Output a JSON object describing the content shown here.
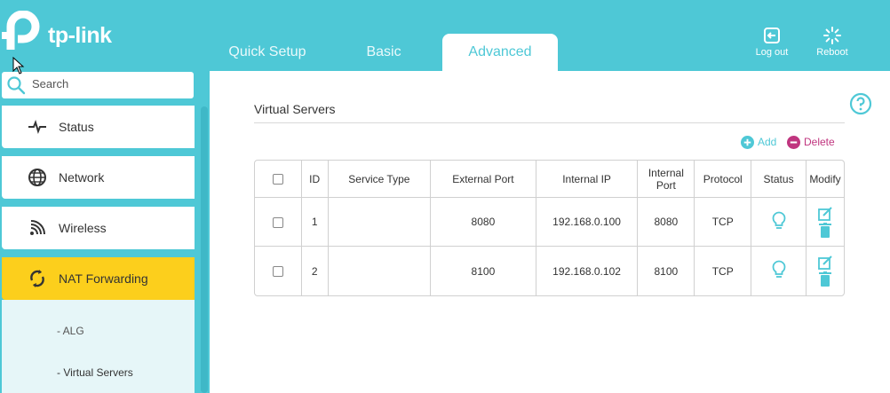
{
  "brand": {
    "logo_text": "tp-link"
  },
  "colors": {
    "header": "#4ec8d6",
    "active_menu": "#fccf1c",
    "delete": "#c0357f"
  },
  "tabs": [
    {
      "label": "Quick Setup",
      "active": false
    },
    {
      "label": "Basic",
      "active": false
    },
    {
      "label": "Advanced",
      "active": true
    }
  ],
  "header_buttons": {
    "logout": {
      "label": "Log out",
      "icon": "logout-icon"
    },
    "reboot": {
      "label": "Reboot",
      "icon": "reboot-icon"
    }
  },
  "sidebar": {
    "search": {
      "placeholder": "Search",
      "value": ""
    },
    "items": [
      {
        "label": "Status",
        "icon": "status-pulse-icon"
      },
      {
        "label": "Network",
        "icon": "globe-icon"
      },
      {
        "label": "Wireless",
        "icon": "wifi-icon"
      },
      {
        "label": "NAT Forwarding",
        "icon": "nat-forwarding-icon",
        "active": true
      }
    ],
    "submenu": [
      {
        "label": "- ALG"
      },
      {
        "label": "- Virtual Servers",
        "active": true
      }
    ]
  },
  "main": {
    "title": "Virtual Servers",
    "actions": {
      "add": "Add",
      "delete": "Delete"
    },
    "table": {
      "headers": {
        "id": "ID",
        "service_type": "Service Type",
        "external_port": "External Port",
        "internal_ip": "Internal IP",
        "internal_port": "Internal Port",
        "protocol": "Protocol",
        "status": "Status",
        "modify": "Modify"
      },
      "rows": [
        {
          "id": "1",
          "service_type": "",
          "external_port": "8080",
          "internal_ip": "192.168.0.100",
          "internal_port": "8080",
          "protocol": "TCP"
        },
        {
          "id": "2",
          "service_type": "",
          "external_port": "8100",
          "internal_ip": "192.168.0.102",
          "internal_port": "8100",
          "protocol": "TCP"
        }
      ]
    }
  }
}
